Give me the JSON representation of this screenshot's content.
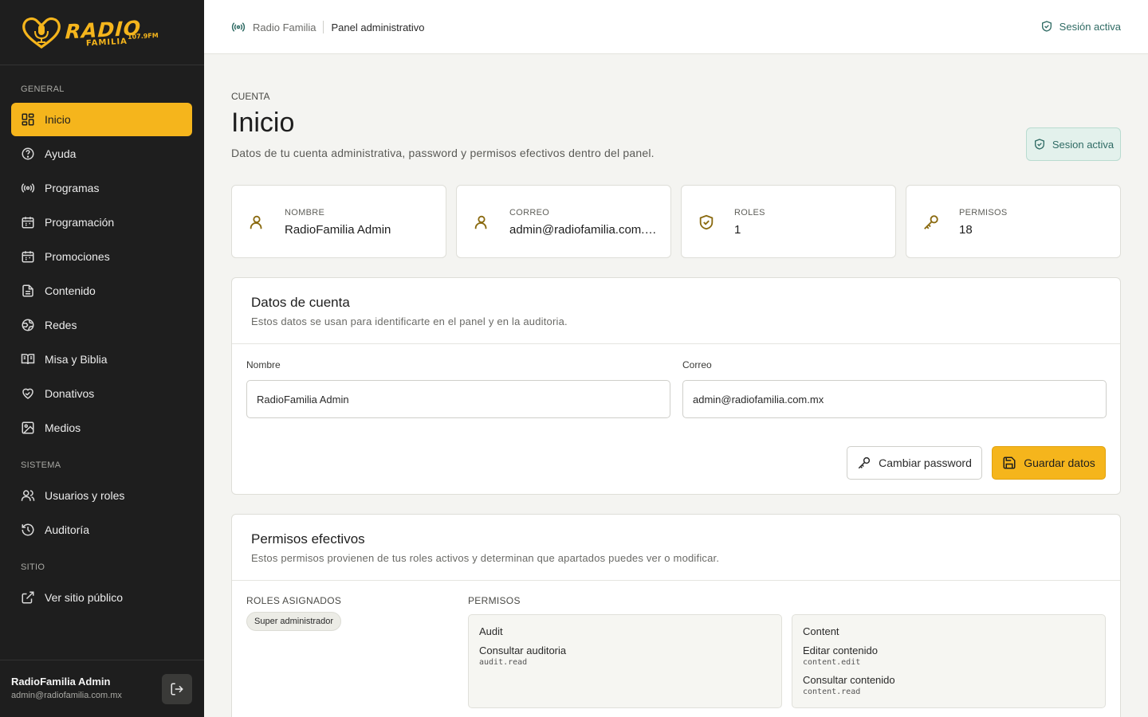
{
  "brand": {
    "logo_word": "RADIO",
    "logo_sub": "FAMILIA",
    "logo_freq": "107.9FM",
    "accent": "#f5b51c",
    "sidebar_bg": "#1e1e1e"
  },
  "sidebar": {
    "sections": {
      "general": "GENERAL",
      "sistema": "SISTEMA",
      "sitio": "SITIO"
    },
    "items": [
      {
        "label": "Inicio",
        "icon": "dashboard-icon",
        "active": true
      },
      {
        "label": "Ayuda",
        "icon": "help-circle-icon"
      },
      {
        "label": "Programas",
        "icon": "radio-waves-icon"
      },
      {
        "label": "Programación",
        "icon": "calendar-icon"
      },
      {
        "label": "Promociones",
        "icon": "calendar-icon"
      },
      {
        "label": "Contenido",
        "icon": "document-icon"
      },
      {
        "label": "Redes",
        "icon": "globe-icon"
      },
      {
        "label": "Misa y Biblia",
        "icon": "book-icon"
      },
      {
        "label": "Donativos",
        "icon": "heart-hand-icon"
      },
      {
        "label": "Medios",
        "icon": "image-icon"
      },
      {
        "label": "Usuarios y roles",
        "icon": "users-icon"
      },
      {
        "label": "Auditoría",
        "icon": "history-icon"
      },
      {
        "label": "Ver sitio público",
        "icon": "external-link-icon"
      }
    ],
    "user": {
      "name": "RadioFamilia Admin",
      "email": "admin@radiofamilia.com.mx"
    }
  },
  "topbar": {
    "crumb_site": "Radio Familia",
    "crumb_page": "Panel administrativo",
    "session": "Sesión activa"
  },
  "header": {
    "eyebrow": "CUENTA",
    "title": "Inicio",
    "description": "Datos de tu cuenta administrativa, password y permisos efectivos dentro del panel.",
    "badge": "Sesion activa"
  },
  "stats": [
    {
      "label": "NOMBRE",
      "value": "RadioFamilia Admin",
      "icon": "user-icon"
    },
    {
      "label": "CORREO",
      "value": "admin@radiofamilia.com.mx",
      "icon": "user-icon"
    },
    {
      "label": "ROLES",
      "value": "1",
      "icon": "shield-check-icon"
    },
    {
      "label": "PERMISOS",
      "value": "18",
      "icon": "key-icon"
    }
  ],
  "account": {
    "title": "Datos de cuenta",
    "subtitle": "Estos datos se usan para identificarte en el panel y en la auditoria.",
    "name_label": "Nombre",
    "name_value": "RadioFamilia Admin",
    "email_label": "Correo",
    "email_value": "admin@radiofamilia.com.mx",
    "change_password": "Cambiar password",
    "save": "Guardar datos"
  },
  "permissions": {
    "title": "Permisos efectivos",
    "subtitle": "Estos permisos provienen de tus roles activos y determinan que apartados puedes ver o modificar.",
    "roles_label": "ROLES ASIGNADOS",
    "perms_label": "PERMISOS",
    "roles": [
      "Super administrador"
    ],
    "groups": [
      {
        "name": "Audit",
        "perms": [
          {
            "name": "Consultar auditoria",
            "code": "audit.read"
          }
        ]
      },
      {
        "name": "Content",
        "perms": [
          {
            "name": "Editar contenido",
            "code": "content.edit"
          },
          {
            "name": "Consultar contenido",
            "code": "content.read"
          }
        ]
      }
    ]
  }
}
